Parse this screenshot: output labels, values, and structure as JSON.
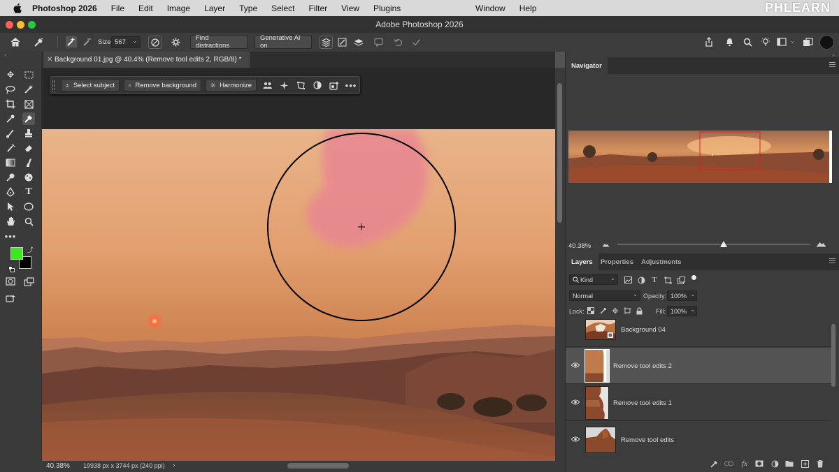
{
  "menubar": {
    "app": "Photoshop 2026",
    "items": [
      "File",
      "Edit",
      "Image",
      "Layer",
      "Type",
      "Select",
      "Filter",
      "View",
      "Plugins"
    ],
    "right_items": [
      "Window",
      "Help"
    ],
    "brand": "PHLEARN"
  },
  "window": {
    "title": "Adobe Photoshop 2026"
  },
  "options": {
    "size_label": "Size",
    "size_value": "567",
    "find_distractions": "Find distractions",
    "generative_ai": "Generative AI on"
  },
  "document": {
    "tab_title": "Background 01.jpg @ 40.4% (Remove tool edits 2, RGB/8) *",
    "context_bar": {
      "select_subject": "Select subject",
      "remove_background": "Remove background",
      "harmonize": "Harmonize"
    },
    "zoom": "40.38%",
    "dimensions": "19938 px x 3744 px (240 ppi)"
  },
  "colors": {
    "foreground": "#3ee81f",
    "background": "#000000",
    "accent": "#2d8cf0"
  },
  "navigator": {
    "title": "Navigator",
    "zoom": "40.38%",
    "zoom_slider_fraction": 0.55
  },
  "layers_panel": {
    "tabs": [
      "Layers",
      "Properties",
      "Adjustments"
    ],
    "filter_kind": "Kind",
    "blend_mode": "Normal",
    "opacity_label": "Opacity:",
    "opacity_value": "100%",
    "lock_label": "Lock:",
    "fill_label": "Fill:",
    "fill_value": "100%",
    "layers": [
      {
        "name": "Background 04",
        "visible": false,
        "selected": false
      },
      {
        "name": "Remove tool edits 2",
        "visible": true,
        "selected": true
      },
      {
        "name": "Remove tool edits 1",
        "visible": true,
        "selected": false
      },
      {
        "name": "Remove tool edits",
        "visible": true,
        "selected": false
      }
    ]
  }
}
